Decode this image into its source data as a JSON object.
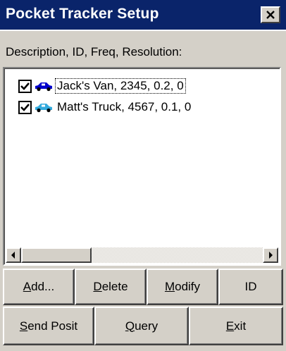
{
  "window": {
    "title": "Pocket Tracker Setup",
    "close_glyph": "close-icon"
  },
  "list": {
    "header": "Description,  ID,  Freq, Resolution:",
    "items": [
      {
        "checked": true,
        "icon": "van-icon",
        "icon_color": "#0000cc",
        "label": "Jack's Van, 2345, 0.2, 0",
        "focused": true
      },
      {
        "checked": true,
        "icon": "truck-icon",
        "icon_color": "#33aadd",
        "label": "Matt's Truck, 4567, 0.1, 0",
        "focused": false
      }
    ]
  },
  "buttons": {
    "add": {
      "mnemonic": "A",
      "rest": "dd..."
    },
    "delete": {
      "mnemonic": "D",
      "rest": "elete"
    },
    "modify": {
      "mnemonic": "M",
      "rest": "odify"
    },
    "id": {
      "label": "ID"
    },
    "send_posit": {
      "mnemonic": "S",
      "rest": "end Posit"
    },
    "query": {
      "mnemonic": "Q",
      "rest": "uery"
    },
    "exit": {
      "mnemonic": "E",
      "rest": "xit"
    }
  },
  "colors": {
    "titlebar": "#0a246a",
    "face": "#d4d0c8"
  }
}
